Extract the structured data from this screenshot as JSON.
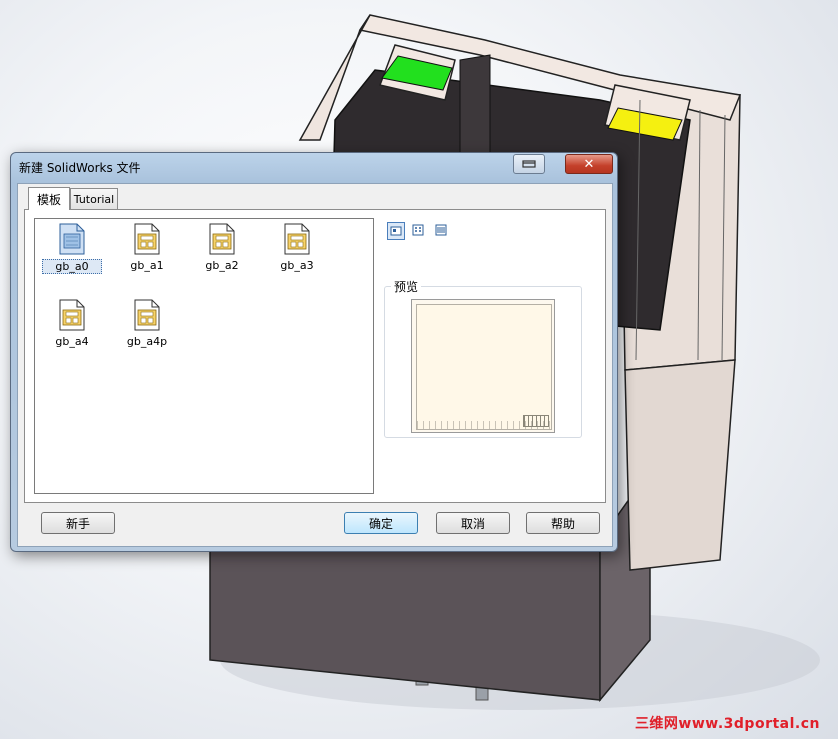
{
  "dialog": {
    "title": "新建 SolidWorks 文件",
    "tabs": [
      {
        "label": "模板",
        "active": true
      },
      {
        "label": "Tutorial",
        "active": false
      }
    ],
    "templates": [
      {
        "label": "gb_a0",
        "selected": true
      },
      {
        "label": "gb_a1",
        "selected": false
      },
      {
        "label": "gb_a2",
        "selected": false
      },
      {
        "label": "gb_a3",
        "selected": false
      },
      {
        "label": "gb_a4",
        "selected": false
      },
      {
        "label": "gb_a4p",
        "selected": false
      }
    ],
    "preview_label": "预览",
    "buttons": {
      "novice": "新手",
      "ok": "确定",
      "cancel": "取消",
      "help": "帮助"
    }
  },
  "watermark": "三维网www.3dportal.cn",
  "colors": {
    "led_green": "#22e01e",
    "led_yellow": "#f5f010",
    "housing": "#f2e8e2",
    "housing_dark": "#3a3438"
  }
}
